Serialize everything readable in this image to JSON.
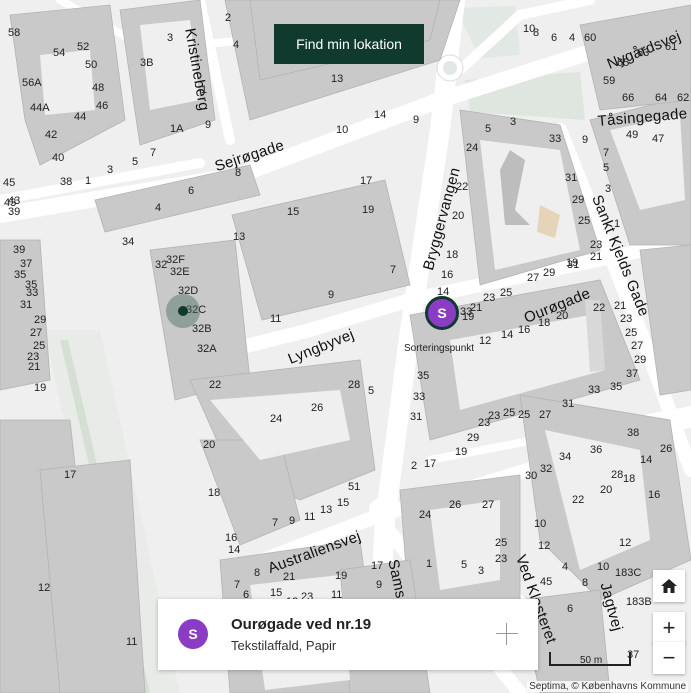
{
  "find_location_button": "Find min lokation",
  "marker": {
    "letter": "S",
    "label": "Sorteringspunkt",
    "color": "#8a3dc4"
  },
  "card": {
    "avatar_letter": "S",
    "title": "Ourøgade ved nr.19",
    "subtitle": "Tekstilaffald, Papir"
  },
  "controls": {
    "home_icon": "home-icon",
    "zoom_in": "+",
    "zoom_out": "−"
  },
  "scale_label": "50 m",
  "attribution": "Septima, © Københavns Kommune",
  "streets": {
    "kristineberg": "Kristineberg",
    "sejroegade": "Sejrøgade",
    "bryggervangen": "Bryggervangen",
    "nygaardsvej": "Nygårdsvej",
    "taasingegade": "Tåsingegade",
    "sankt_kjelds": "Sankt Kjelds Gade",
    "ouroegade": "Ourøgade",
    "lyngbyvej": "Lyngbyvej",
    "australiensvej": "Australiensvej",
    "samsoe": "Sams",
    "ved_klosteret": "Ved Klosteret",
    "jagtvej": "Jagtvej"
  },
  "house_numbers": {
    "n01": "58",
    "n02": "54",
    "n03": "52",
    "n04": "50",
    "n05": "48",
    "n06": "46",
    "n07": "56A",
    "n08": "44A",
    "n09": "44",
    "n10": "42",
    "n11": "40",
    "n12": "38",
    "n13": "1",
    "n14": "3",
    "n15": "5",
    "n16": "7",
    "n17": "3",
    "n18": "3B",
    "n19": "1",
    "n20": "1A",
    "n21": "9",
    "n22": "2",
    "n23": "4",
    "n24": "13",
    "n25": "10",
    "n26": "14",
    "n27": "9",
    "n28": "8",
    "n29": "4",
    "n30": "6",
    "n31": "34",
    "n32": "15",
    "n33": "17",
    "n34": "19",
    "n35": "13",
    "n36": "7",
    "n37": "9",
    "n38": "11",
    "n39": "32",
    "n40": "32F",
    "n41": "32E",
    "n42": "32D",
    "n43": "32C",
    "n44": "32B",
    "n45": "32A",
    "n46": "22",
    "n47": "20",
    "n48": "18",
    "n49": "16",
    "n50": "14",
    "n51": "24",
    "n52": "26",
    "n53": "28",
    "n54": "5",
    "n55": "7",
    "n56": "9",
    "n57": "11",
    "n58": "13",
    "n59": "15",
    "n60": "51",
    "n61": "45",
    "n62": "43",
    "n63": "39",
    "n64": "35",
    "n65": "33",
    "n66": "31",
    "n67": "29",
    "n68": "27",
    "n69": "25",
    "n70": "23",
    "n71": "21",
    "n72": "19",
    "n73": "17",
    "n74": "12",
    "n75": "11",
    "n76": "24",
    "n77": "22",
    "n78": "20",
    "n79": "18",
    "n80": "16",
    "n81": "14",
    "n82": "3",
    "n83": "5",
    "n84": "33",
    "n85": "31",
    "n86": "29",
    "n87": "25",
    "n88": "23",
    "n89": "21",
    "n90": "19",
    "n91": "12",
    "n92": "14",
    "n93": "16",
    "n94": "18",
    "n95": "20",
    "n96": "22",
    "n97": "21",
    "n98": "23",
    "n99": "25",
    "n100": "27",
    "n101": "29",
    "n102": "31",
    "n103": "33",
    "n104": "35",
    "n105": "37",
    "n106": "2",
    "n107": "17",
    "n108": "19",
    "n109": "23",
    "n110": "25",
    "n111": "23",
    "n112": "38",
    "n113": "36",
    "n114": "34",
    "n115": "32",
    "n116": "30",
    "n117": "28",
    "n118": "26",
    "n119": "10",
    "n120": "8",
    "n121": "6",
    "n122": "4",
    "n123": "60",
    "n124": "65",
    "n125": "63",
    "n126": "61",
    "n127": "59",
    "n128": "66",
    "n129": "64",
    "n130": "62",
    "n131": "49",
    "n132": "47",
    "n133": "9",
    "n134": "7",
    "n135": "5",
    "n136": "3",
    "n137": "1",
    "n138": "24",
    "n139": "26",
    "n140": "27",
    "n141": "25",
    "n142": "23",
    "n143": "10",
    "n144": "12",
    "n145": "14",
    "n146": "16",
    "n147": "18",
    "n148": "20",
    "n149": "22",
    "n150": "4",
    "n151": "6",
    "n152": "8",
    "n153": "10",
    "n154": "12",
    "n155": "183C",
    "n156": "183B",
    "n157": "8",
    "n158": "6",
    "n159": "37",
    "n160": "35",
    "n161": "33",
    "n162": "31",
    "n163": "29",
    "n164": "27",
    "n165": "25",
    "n166": "23",
    "n167": "21",
    "n168": "19",
    "n169": "17",
    "n170": "15",
    "n171": "13",
    "n172": "11",
    "n173": "9",
    "n174": "7",
    "n175": "5",
    "n176": "3",
    "n177": "1",
    "n178": "45",
    "n179": "43",
    "n180": "39",
    "n181": "37",
    "n182": "35",
    "n183": "33",
    "n184": "31",
    "n185": "29",
    "n186": "27",
    "n187": "25",
    "n188": "23",
    "n189": "21",
    "n190": "19"
  }
}
